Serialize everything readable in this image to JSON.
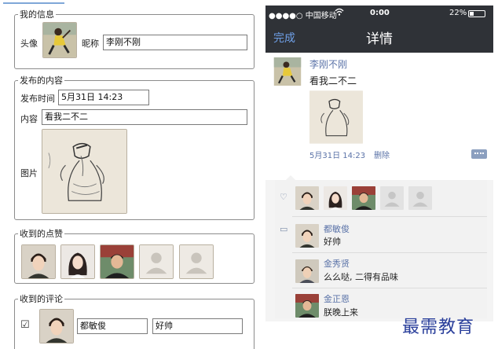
{
  "left_form": {
    "info": {
      "legend": "我的信息",
      "avatar_label": "头像",
      "nickname_label": "昵称",
      "nickname_value": "李刚不刚"
    },
    "content": {
      "legend": "发布的内容",
      "time_label": "发布时间",
      "time_value": "5月31日 14:23",
      "text_label": "内容",
      "text_value": "看我二不二",
      "image_label": "图片"
    },
    "likes": {
      "legend": "收到的点赞"
    },
    "comments": {
      "legend": "收到的评论",
      "checkbox_glyph": "☑",
      "author_value": "都敏俊",
      "text_value": "好帅"
    }
  },
  "phone": {
    "status": {
      "carrier": "●●●●○ 中国移动",
      "wifi_icon": "wifi-icon",
      "time": "0:00",
      "battery": "22%"
    },
    "nav": {
      "done": "完成",
      "title": "详情"
    },
    "post": {
      "name": "李刚不刚",
      "text": "看我二不二",
      "time": "5月31日 14:23",
      "delete": "删除"
    },
    "comments": [
      {
        "name": "都敏俊",
        "text": "好帅"
      },
      {
        "name": "金秀贤",
        "text": "么么哒, 二得有品味"
      },
      {
        "name": "金正恩",
        "text": "朕晚上来"
      }
    ]
  },
  "watermark": "最需教育",
  "colors": {
    "nav_bg": "#2f3237",
    "link_blue": "#5b73a8",
    "done_blue": "#6fa0e8",
    "watermark_blue": "#2a3f9b"
  }
}
